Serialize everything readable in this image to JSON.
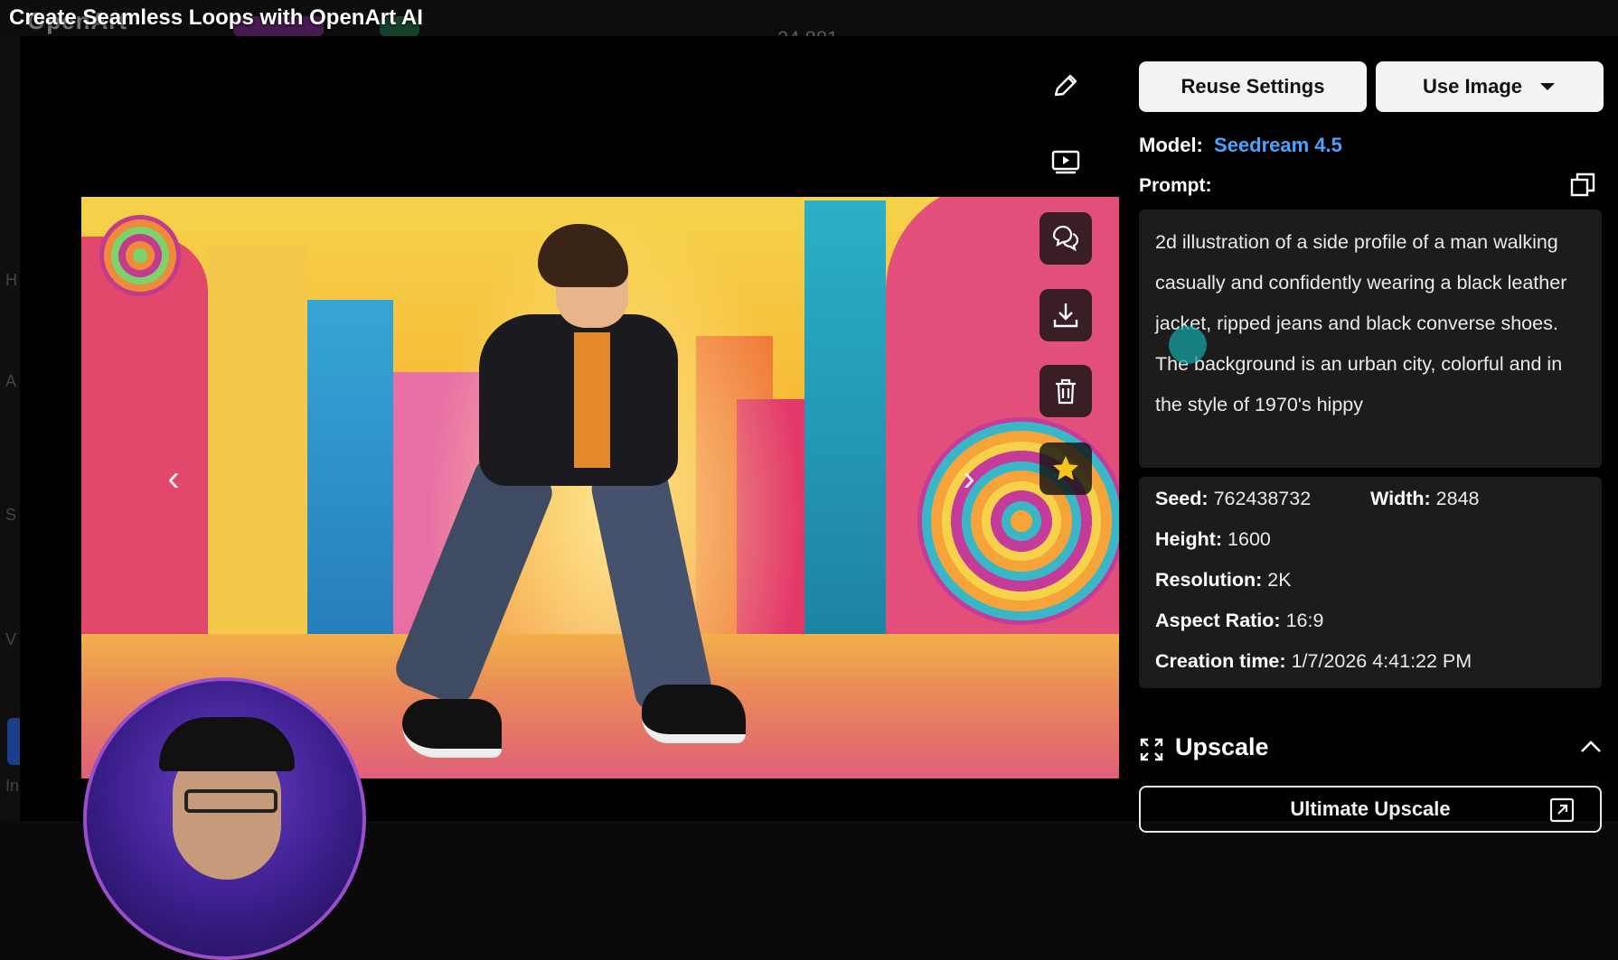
{
  "video": {
    "title": "Create Seamless Loops with OpenArt AI"
  },
  "app_bar": {
    "logo": "OpenArt",
    "credits": "24,881"
  },
  "left_rail": {
    "letters": [
      "H",
      "A",
      "S",
      "V",
      "In"
    ]
  },
  "viewer": {
    "tools": [
      "edit-icon",
      "video-icon",
      "chat-icon",
      "download-icon",
      "trash-icon",
      "star-icon"
    ],
    "prev_label": "‹",
    "next_label": "›",
    "colors": {
      "star": "#f5c518"
    }
  },
  "panel": {
    "reuse_button": "Reuse Settings",
    "use_image_button": "Use Image",
    "model_label": "Model:",
    "model_value": "Seedream 4.5",
    "prompt_label": "Prompt:",
    "prompt_text": "2d illustration of a side profile of a man walking casually and confidently wearing a black leather jacket, ripped jeans and black converse shoes. The background is an urban city, colorful and in the style of 1970's hippy",
    "meta": {
      "seed_label": "Seed:",
      "seed": "762438732",
      "width_label": "Width:",
      "width": "2848",
      "height_label": "Height:",
      "height": "1600",
      "resolution_label": "Resolution:",
      "resolution": "2K",
      "aspect_label": "Aspect Ratio:",
      "aspect": "16:9",
      "created_label": "Creation time:",
      "created": "1/7/2026 4:41:22 PM"
    },
    "upscale": {
      "title": "Upscale",
      "button": "Ultimate Upscale"
    },
    "colors": {
      "accent": "#4aa3ff"
    }
  }
}
